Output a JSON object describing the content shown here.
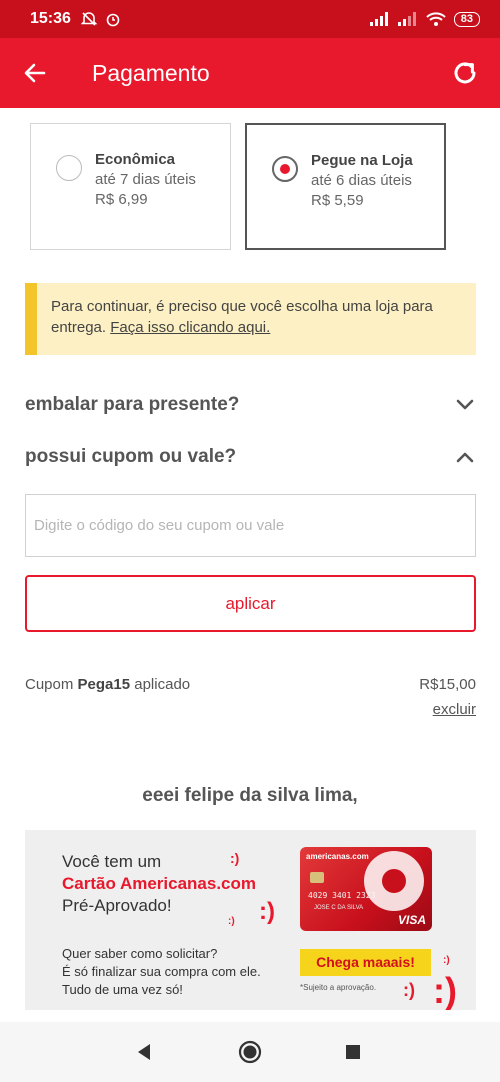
{
  "status_bar": {
    "time": "15:36",
    "battery": "83"
  },
  "app_bar": {
    "title": "Pagamento"
  },
  "shipping_options": [
    {
      "name": "Econômica",
      "delivery": "até 7 dias úteis",
      "price": "R$ 6,99",
      "selected": false
    },
    {
      "name": "Pegue na Loja",
      "delivery": "até 6 dias úteis",
      "price": "R$ 5,59",
      "selected": true
    }
  ],
  "alert": {
    "text": "Para continuar, é preciso que você escolha uma loja para entrega.",
    "link": "Faça isso clicando aqui."
  },
  "gift_wrap": {
    "title": "embalar para presente?"
  },
  "coupon_section": {
    "title": "possui cupom ou vale?",
    "placeholder": "Digite o código do seu cupom ou vale",
    "apply_label": "aplicar",
    "applied_prefix": "Cupom",
    "code": "Pega15",
    "applied_suffix": "aplicado",
    "value": "R$15,00",
    "remove_label": "excluir"
  },
  "greeting": "eeei felipe da silva lima,",
  "promo": {
    "line1": "Você tem um",
    "line2": "Cartão Americanas.com",
    "line3": "Pré-Aprovado!",
    "sub1": "Quer saber como solicitar?",
    "sub2": "É só finalizar sua compra com ele.",
    "sub3": "Tudo de uma vez só!",
    "cta": "Chega maaais!",
    "note": "*Sujeito a aprovação.",
    "card_brand": "americanas.com",
    "card_number": "4029 3401 2323",
    "card_holder": "JOSE C DA SILVA",
    "card_network": "VISA"
  },
  "colors": {
    "primary": "#e8192c",
    "status": "#c8101c",
    "alert_bg": "#fcf0c4",
    "alert_border": "#f4c52a",
    "cta": "#f7d41c"
  },
  "icons": [
    "arrow-left-icon",
    "refresh-icon",
    "chevron-down-icon",
    "chevron-up-icon",
    "nav-back-icon",
    "nav-home-icon",
    "nav-recents-icon"
  ]
}
